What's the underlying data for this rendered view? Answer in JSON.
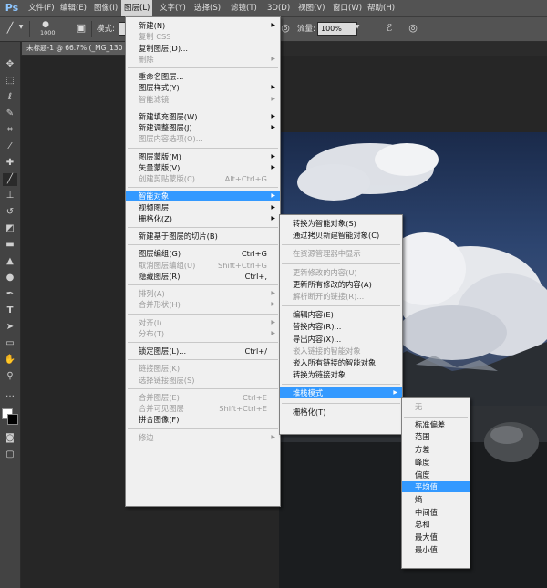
{
  "app": {
    "logo": "Ps"
  },
  "menubar": {
    "items": [
      "文件(F)",
      "编辑(E)",
      "图像(I)",
      "图层(L)",
      "文字(Y)",
      "选择(S)",
      "滤镜(T)",
      "3D(D)",
      "视图(V)",
      "窗口(W)",
      "帮助(H)"
    ],
    "active": "图层(L)"
  },
  "options_bar": {
    "brush_size": "1000",
    "mode_label": "模式:",
    "flow_label": "流量:",
    "flow_value": "100%"
  },
  "document_tab": {
    "title": "未标题-1 @ 66.7% (_MG_130"
  },
  "layer_menu": {
    "items": [
      {
        "label": "新建(N)",
        "arrow": true
      },
      {
        "label": "复制 CSS",
        "disabled": true
      },
      {
        "label": "复制图层(D)..."
      },
      {
        "label": "删除",
        "disabled": true,
        "arrow": true
      },
      {
        "divider": true
      },
      {
        "label": "重命名图层..."
      },
      {
        "label": "图层样式(Y)",
        "arrow": true
      },
      {
        "label": "智能滤镜",
        "disabled": true,
        "arrow": true
      },
      {
        "divider": true
      },
      {
        "label": "新建填充图层(W)",
        "arrow": true
      },
      {
        "label": "新建调整图层(J)",
        "arrow": true
      },
      {
        "label": "图层内容选项(O)...",
        "disabled": true
      },
      {
        "divider": true
      },
      {
        "label": "图层蒙版(M)",
        "arrow": true
      },
      {
        "label": "矢量蒙版(V)",
        "arrow": true
      },
      {
        "label": "创建剪贴蒙版(C)",
        "disabled": true,
        "shortcut": "Alt+Ctrl+G"
      },
      {
        "divider": true
      },
      {
        "label": "智能对象",
        "arrow": true,
        "highlight": true
      },
      {
        "label": "视频图层",
        "arrow": true
      },
      {
        "label": "栅格化(Z)",
        "arrow": true
      },
      {
        "divider": true
      },
      {
        "label": "新建基于图层的切片(B)"
      },
      {
        "divider": true
      },
      {
        "label": "图层编组(G)",
        "shortcut": "Ctrl+G"
      },
      {
        "label": "取消图层编组(U)",
        "disabled": true,
        "shortcut": "Shift+Ctrl+G"
      },
      {
        "label": "隐藏图层(R)",
        "shortcut": "Ctrl+,"
      },
      {
        "divider": true
      },
      {
        "label": "排列(A)",
        "disabled": true,
        "arrow": true
      },
      {
        "label": "合并形状(H)",
        "disabled": true,
        "arrow": true
      },
      {
        "divider": true
      },
      {
        "label": "对齐(I)",
        "disabled": true,
        "arrow": true
      },
      {
        "label": "分布(T)",
        "disabled": true,
        "arrow": true
      },
      {
        "divider": true
      },
      {
        "label": "锁定图层(L)...",
        "shortcut": "Ctrl+/"
      },
      {
        "divider": true
      },
      {
        "label": "链接图层(K)",
        "disabled": true
      },
      {
        "label": "选择链接图层(S)",
        "disabled": true
      },
      {
        "divider": true
      },
      {
        "label": "合并图层(E)",
        "disabled": true,
        "shortcut": "Ctrl+E"
      },
      {
        "label": "合并可见图层",
        "disabled": true,
        "shortcut": "Shift+Ctrl+E"
      },
      {
        "label": "拼合图像(F)"
      },
      {
        "divider": true
      },
      {
        "label": "修边",
        "disabled": true,
        "arrow": true
      }
    ]
  },
  "smart_object_menu": {
    "items": [
      {
        "label": "转换为智能对象(S)"
      },
      {
        "label": "通过拷贝新建智能对象(C)"
      },
      {
        "divider": true
      },
      {
        "label": "在资源管理器中显示",
        "disabled": true
      },
      {
        "divider": true
      },
      {
        "label": "更新修改的内容(U)",
        "disabled": true
      },
      {
        "label": "更新所有修改的内容(A)"
      },
      {
        "label": "解析断开的链接(R)...",
        "disabled": true
      },
      {
        "divider": true
      },
      {
        "label": "编辑内容(E)"
      },
      {
        "label": "替换内容(R)..."
      },
      {
        "label": "导出内容(X)..."
      },
      {
        "label": "嵌入链接的智能对象",
        "disabled": true
      },
      {
        "label": "嵌入所有链接的智能对象"
      },
      {
        "label": "转换为链接对象..."
      },
      {
        "divider": true
      },
      {
        "label": "堆栈模式",
        "arrow": true,
        "highlight": true
      },
      {
        "divider": true
      },
      {
        "label": "栅格化(T)"
      }
    ]
  },
  "stack_mode_menu": {
    "items": [
      {
        "label": "无",
        "disabled": true
      },
      {
        "divider": true
      },
      {
        "label": "标准偏差"
      },
      {
        "label": "范围"
      },
      {
        "label": "方差"
      },
      {
        "label": "峰度"
      },
      {
        "label": "偏度"
      },
      {
        "label": "平均值",
        "highlight": true
      },
      {
        "label": "熵"
      },
      {
        "label": "中间值"
      },
      {
        "label": "总和"
      },
      {
        "label": "最大值"
      },
      {
        "label": "最小值"
      }
    ]
  },
  "tools": [
    "move-icon",
    "marquee-icon",
    "lasso-icon",
    "quick-select-icon",
    "crop-icon",
    "eyedropper-icon",
    "healing-icon",
    "brush-icon",
    "stamp-icon",
    "history-brush-icon",
    "eraser-icon",
    "gradient-icon",
    "blur-icon",
    "dodge-icon",
    "pen-icon",
    "type-icon",
    "path-select-icon",
    "shape-icon",
    "hand-icon",
    "zoom-icon"
  ]
}
